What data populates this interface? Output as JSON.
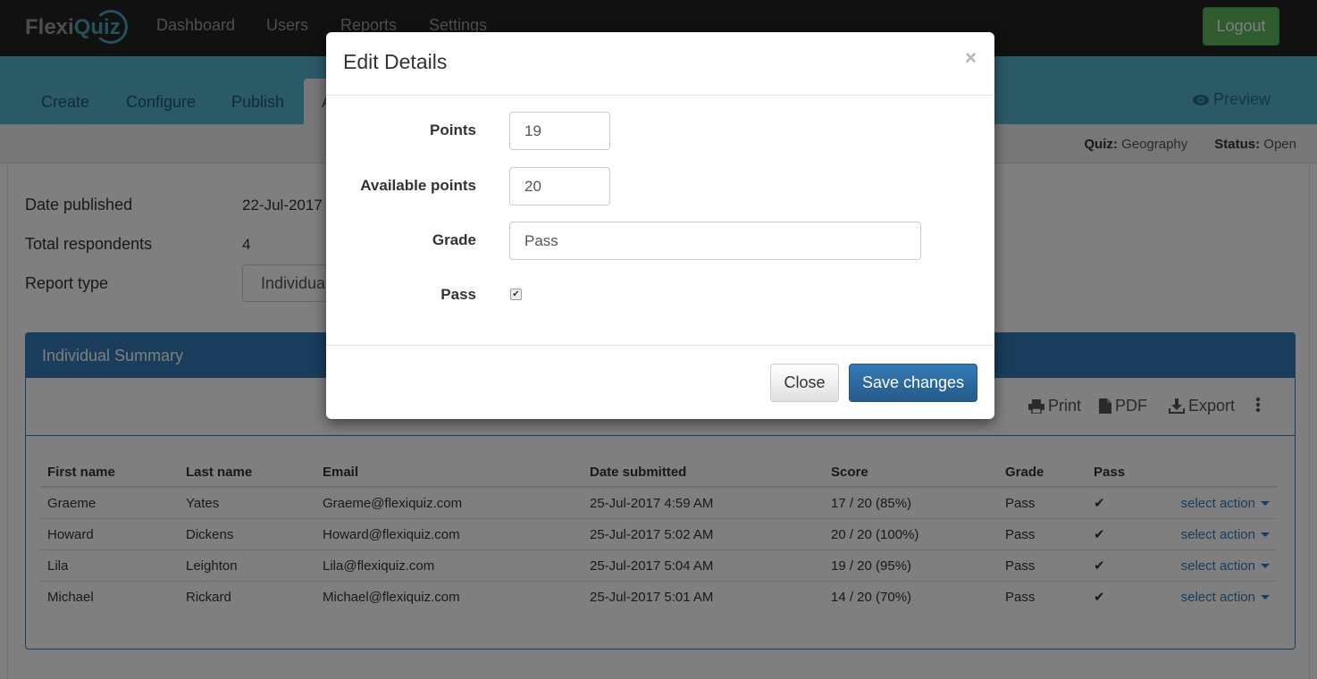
{
  "navbar": {
    "logo": {
      "part1": "Flexi",
      "part2": "Quiz"
    },
    "links": [
      "Dashboard",
      "Users",
      "Reports",
      "Settings"
    ],
    "logout_label": "Logout"
  },
  "tabs": [
    {
      "label": "Create"
    },
    {
      "label": "Configure"
    },
    {
      "label": "Publish"
    },
    {
      "label": "A",
      "active": true
    }
  ],
  "preview_label": "Preview",
  "info": {
    "quiz_label": "Quiz:",
    "quiz_value": "Geography",
    "status_label": "Status:",
    "status_value": "Open"
  },
  "summary": {
    "date_published_label": "Date published",
    "date_published_value": "22-Jul-2017",
    "total_respondents_label": "Total respondents",
    "total_respondents_value": "4",
    "report_type_label": "Report type",
    "report_type_value": "Individual"
  },
  "panel": {
    "title": "Individual Summary",
    "tools": {
      "print": "Print",
      "pdf": "PDF",
      "export": "Export"
    },
    "columns": [
      "First name",
      "Last name",
      "Email",
      "Date submitted",
      "Score",
      "Grade",
      "Pass",
      ""
    ],
    "rows": [
      {
        "first": "Graeme",
        "last": "Yates",
        "email": "Graeme@flexiquiz.com",
        "date": "25-Jul-2017 4:59 AM",
        "score": "17 / 20 (85%)",
        "grade": "Pass",
        "pass": "✔",
        "action": "select action"
      },
      {
        "first": "Howard",
        "last": "Dickens",
        "email": "Howard@flexiquiz.com",
        "date": "25-Jul-2017 5:02 AM",
        "score": "20 / 20 (100%)",
        "grade": "Pass",
        "pass": "✔",
        "action": "select action"
      },
      {
        "first": "Lila",
        "last": "Leighton",
        "email": "Lila@flexiquiz.com",
        "date": "25-Jul-2017 5:04 AM",
        "score": "19 / 20 (95%)",
        "grade": "Pass",
        "pass": "✔",
        "action": "select action"
      },
      {
        "first": "Michael",
        "last": "Rickard",
        "email": "Michael@flexiquiz.com",
        "date": "25-Jul-2017 5:01 AM",
        "score": "14 / 20 (70%)",
        "grade": "Pass",
        "pass": "✔",
        "action": "select action"
      }
    ]
  },
  "modal": {
    "title": "Edit Details",
    "close_glyph": "×",
    "fields": {
      "points_label": "Points",
      "points_value": "19",
      "available_label": "Available points",
      "available_value": "20",
      "grade_label": "Grade",
      "grade_value": "Pass",
      "pass_label": "Pass",
      "pass_checked": true
    },
    "close_label": "Close",
    "save_label": "Save changes"
  }
}
